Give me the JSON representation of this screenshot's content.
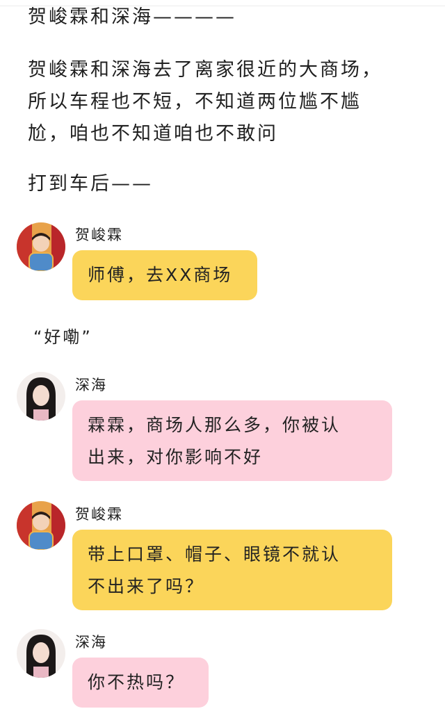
{
  "story": {
    "header": "贺峻霖和深海————",
    "para1": [
      "贺峻霖和深海去了离家很近的大商场，",
      "所以车程也不短，不知道两位尴不尴",
      "尬，咱也不知道咱也不敢问"
    ],
    "para2": "打到车后——",
    "quote": "“好嘞”"
  },
  "messages": [
    {
      "speaker": "贺峻霖",
      "avatar": "male-avatar",
      "color": "#fbd55a",
      "lines": [
        "师傅，去XX商场"
      ]
    },
    {
      "speaker": "深海",
      "avatar": "female-avatar",
      "color": "#fdd0dc",
      "lines": [
        "霖霖，商场人那么多，你被认",
        "出来，对你影响不好"
      ]
    },
    {
      "speaker": "贺峻霖",
      "avatar": "male-avatar",
      "color": "#fbd55a",
      "lines": [
        "带上口罩、帽子、眼镜不就认",
        "不出来了吗？"
      ]
    },
    {
      "speaker": "深海",
      "avatar": "female-avatar",
      "color": "#fdd0dc",
      "lines": [
        "你不热吗？"
      ]
    }
  ]
}
